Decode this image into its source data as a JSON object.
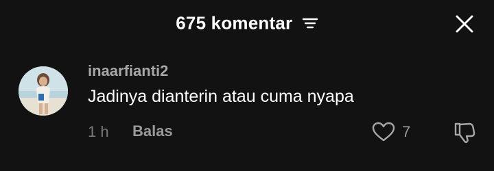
{
  "header": {
    "title": "675 komentar",
    "filter_icon": "filter-icon",
    "close_icon": "close-icon"
  },
  "comment": {
    "avatar_icon": "avatar",
    "username": "inaarfianti2",
    "text": "Jadinya dianterin atau cuma nyapa",
    "time": "1 h",
    "reply_label": "Balas",
    "like_icon": "heart-icon",
    "like_count": "7",
    "dislike_icon": "thumbs-down-icon"
  },
  "colors": {
    "background": "#121212",
    "primary_text": "#ffffff",
    "secondary_text": "#a8a8a8",
    "muted_text": "#7a7a7a"
  }
}
